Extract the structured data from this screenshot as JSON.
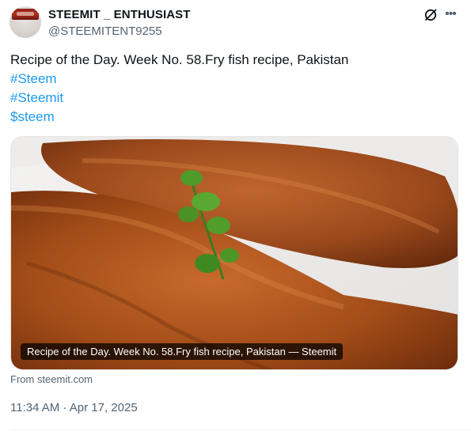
{
  "author": {
    "name": "STEEMIT _ ENTHUSIAST",
    "handle": "@STEEMITENT9255"
  },
  "icons": {
    "grok": "grok-icon",
    "more": "more-icon",
    "avatar": "avatar-image"
  },
  "post": {
    "text": "Recipe of the Day. Week No. 58.Fry fish recipe, Pakistan",
    "hashtags": [
      "#Steem",
      "#Steemit",
      "$steem"
    ]
  },
  "media": {
    "caption": "Recipe of the Day. Week No. 58.Fry fish recipe, Pakistan — Steemit",
    "source": "From steemit.com"
  },
  "timestamp": "11:34 AM · Apr 17, 2025",
  "colors": {
    "link": "#1d9bf0",
    "secondary_text": "#536471",
    "primary_text": "#0f1419"
  }
}
